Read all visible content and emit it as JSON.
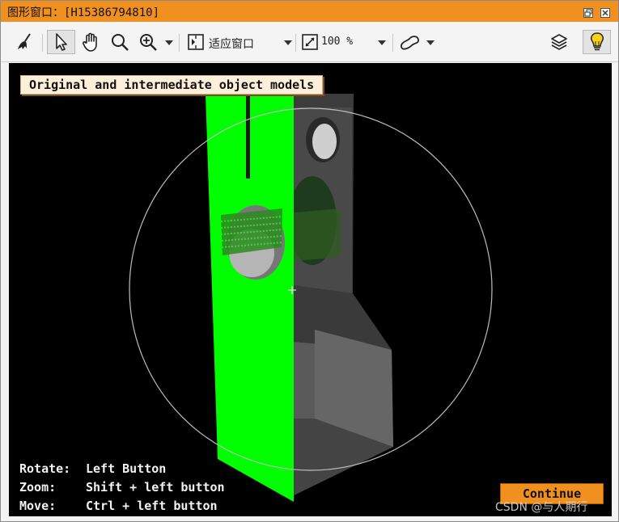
{
  "window": {
    "title": "图形窗口：[H15386794810]",
    "restore_icon": "restore-window-icon",
    "close_icon": "close-window-icon"
  },
  "toolbar": {
    "tools": [
      {
        "name": "clear",
        "icon": "broom-icon"
      },
      {
        "name": "select",
        "icon": "pointer-icon",
        "active": true
      },
      {
        "name": "pan",
        "icon": "hand-icon"
      },
      {
        "name": "magnify",
        "icon": "magnifier-icon"
      },
      {
        "name": "zoom",
        "icon": "zoom-in-icon"
      },
      {
        "name": "fit",
        "icon": "fit-window-icon"
      },
      {
        "name": "scale",
        "icon": "scale-icon"
      },
      {
        "name": "shape",
        "icon": "draw-shape-icon"
      },
      {
        "name": "layers",
        "icon": "layers-icon"
      },
      {
        "name": "hint",
        "icon": "lightbulb-icon"
      }
    ],
    "fit_label": "适应窗口",
    "zoom_value": "100 %"
  },
  "canvas": {
    "banner": "Original and intermediate object models",
    "help": [
      {
        "action": "Rotate:",
        "binding": "Left Button"
      },
      {
        "action": "Zoom:",
        "binding": "Shift + left button"
      },
      {
        "action": "Move:",
        "binding": "Ctrl + left button"
      }
    ],
    "continue_label": "Continue",
    "colors": {
      "background": "#000000",
      "model_green": "#00ff00",
      "model_gray": "#5a5a5a",
      "banner_bg": "#fdefd9",
      "accent": "#f0901e"
    }
  },
  "watermark": "CSDN @与人期行"
}
